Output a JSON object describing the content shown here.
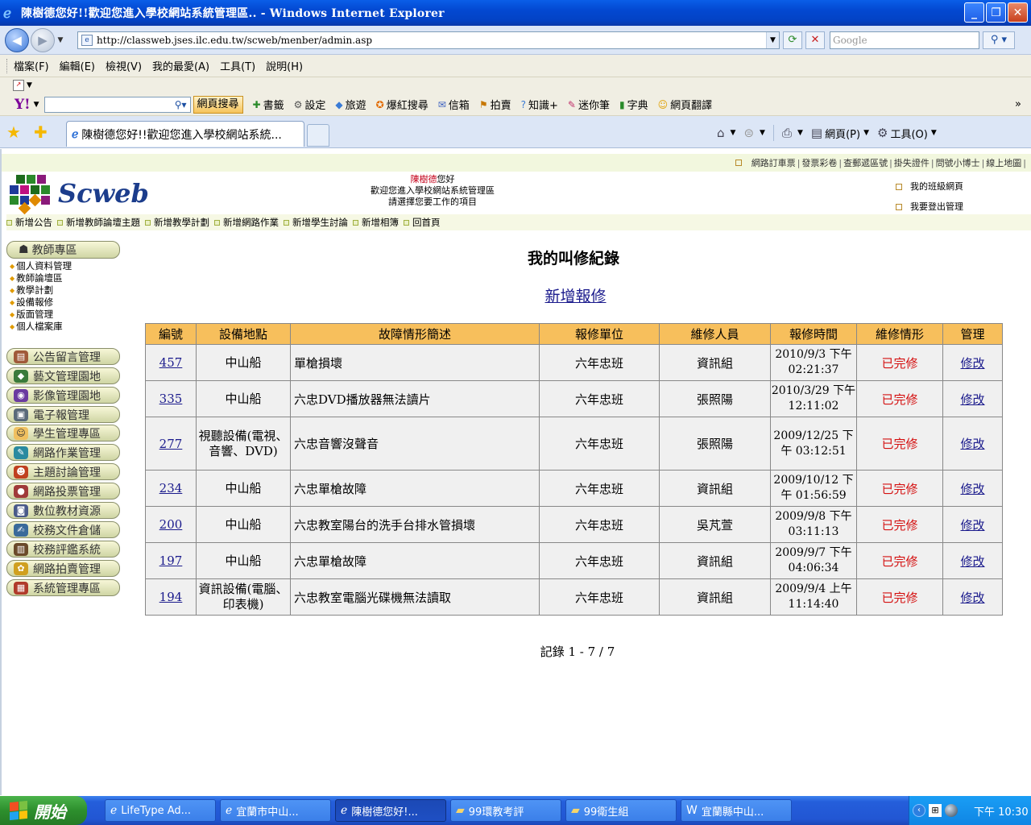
{
  "window": {
    "title": "陳樹德您好!!歡迎您進入學校網站系統管理區.. - Windows Internet Explorer"
  },
  "addressbar": {
    "url": "http://classweb.jses.ilc.edu.tw/scweb/menber/admin.asp",
    "search_placeholder": "Google"
  },
  "menubar": [
    "檔案(F)",
    "編輯(E)",
    "檢視(V)",
    "我的最愛(A)",
    "工具(T)",
    "說明(H)"
  ],
  "yahoo_toolbar": {
    "search_button": "網頁搜尋",
    "items": [
      "書籤",
      "設定",
      "旅遊",
      "爆紅搜尋",
      "信箱",
      "拍賣",
      "知識+",
      "迷你筆",
      "字典",
      "網頁翻譯"
    ]
  },
  "tab": {
    "title": "陳樹德您好!!歡迎您進入學校網站系統..."
  },
  "commandbar": {
    "page": "網頁(P)",
    "tools": "工具(O)"
  },
  "site": {
    "top_links": [
      "網路訂車票",
      "發票彩卷",
      "查郵遞區號",
      "掛失證件",
      "問號小博士",
      "線上地圖"
    ],
    "logo_text": "Scweb",
    "welcome_name": "陳樹德",
    "welcome_suffix": "您好",
    "welcome_line2": "歡迎您進入學校網站系統管理區",
    "welcome_line3": "請選擇您要工作的項目",
    "right_links": [
      "我的班級網頁",
      "我要登出管理"
    ],
    "subnav": [
      "新增公告",
      "新增教師論壇主題",
      "新增教學計劃",
      "新增網路作業",
      "新增學生討論",
      "新增相簿",
      "回首頁"
    ]
  },
  "sidebar": {
    "teacher_zone": "教師專區",
    "teacher_items": [
      "個人資料管理",
      "教師論壇區",
      "教學計劃",
      "設備報修",
      "版面管理",
      "個人檔案庫"
    ],
    "modules": [
      "公告留言管理",
      "藝文管理園地",
      "影像管理園地",
      "電子報管理",
      "學生管理專區",
      "網路作業管理",
      "主題討論管理",
      "網路投票管理",
      "數位教材資源",
      "校務文件倉儲",
      "校務評鑑系統",
      "網路拍賣管理",
      "系統管理專區"
    ]
  },
  "main": {
    "title": "我的叫修紀錄",
    "add_link": "新增報修",
    "columns": [
      "編號",
      "設備地點",
      "故障情形簡述",
      "報修單位",
      "維修人員",
      "報修時間",
      "維修情形",
      "管理"
    ],
    "rows": [
      {
        "id": "457",
        "place": "中山船",
        "desc": "單槍損壞",
        "unit": "六年忠班",
        "staff": "資訊組",
        "time": "2010/9/3 下午 02:21:37",
        "status": "已完修",
        "action": "修改"
      },
      {
        "id": "335",
        "place": "中山船",
        "desc": "六忠DVD播放器無法讀片",
        "unit": "六年忠班",
        "staff": "張照陽",
        "time": "2010/3/29 下午 12:11:02",
        "status": "已完修",
        "action": "修改"
      },
      {
        "id": "277",
        "place": "視聽設備(電視、音響、DVD)",
        "desc": "六忠音響沒聲音",
        "unit": "六年忠班",
        "staff": "張照陽",
        "time": "2009/12/25 下午 03:12:51",
        "status": "已完修",
        "action": "修改"
      },
      {
        "id": "234",
        "place": "中山船",
        "desc": "六忠單槍故障",
        "unit": "六年忠班",
        "staff": "資訊組",
        "time": "2009/10/12 下午 01:56:59",
        "status": "已完修",
        "action": "修改"
      },
      {
        "id": "200",
        "place": "中山船",
        "desc": "六忠教室陽台的洗手台排水管損壞",
        "unit": "六年忠班",
        "staff": "吳芃萱",
        "time": "2009/9/8 下午 03:11:13",
        "status": "已完修",
        "action": "修改"
      },
      {
        "id": "197",
        "place": "中山船",
        "desc": "六忠單槍故障",
        "unit": "六年忠班",
        "staff": "資訊組",
        "time": "2009/9/7 下午 04:06:34",
        "status": "已完修",
        "action": "修改"
      },
      {
        "id": "194",
        "place": "資訊設備(電腦、印表機)",
        "desc": "六忠教室電腦光碟機無法讀取",
        "unit": "六年忠班",
        "staff": "資訊組",
        "time": "2009/9/4 上午 11:14:40",
        "status": "已完修",
        "action": "修改"
      }
    ],
    "records": "記錄 1 - 7 / 7"
  },
  "taskbar": {
    "start": "開始",
    "items": [
      "LifeType Ad...",
      "宜蘭市中山...",
      "陳樹德您好!...",
      "99環教考評",
      "99衛生組",
      "宜蘭縣中山..."
    ],
    "clock": "下午 10:30"
  }
}
